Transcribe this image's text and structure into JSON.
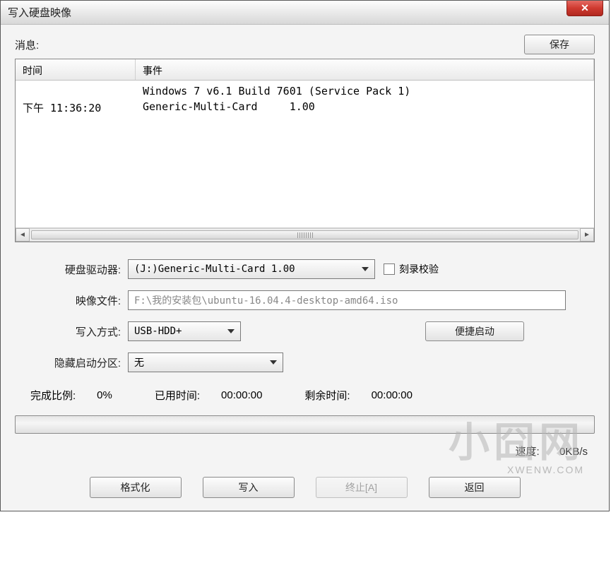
{
  "window": {
    "title": "写入硬盘映像"
  },
  "top": {
    "msg_label": "消息:",
    "save_btn": "保存"
  },
  "log": {
    "col_time": "时间",
    "col_event": "事件",
    "rows": [
      {
        "time": "",
        "event": "Windows 7 v6.1 Build 7601 (Service Pack 1)"
      },
      {
        "time": "下午 11:36:20",
        "event": "Generic-Multi-Card     1.00"
      }
    ]
  },
  "form": {
    "drive_label": "硬盘驱动器:",
    "drive_value": "(J:)Generic-Multi-Card     1.00",
    "verify_label": "刻录校验",
    "image_label": "映像文件:",
    "image_value": "F:\\我的安装包\\ubuntu-16.04.4-desktop-amd64.iso",
    "write_mode_label": "写入方式:",
    "write_mode_value": "USB-HDD+",
    "quick_boot_btn": "便捷启动",
    "hidden_label": "隐藏启动分区:",
    "hidden_value": "无"
  },
  "stats": {
    "done_label": "完成比例:",
    "done_value": "0%",
    "elapsed_label": "已用时间:",
    "elapsed_value": "00:00:00",
    "remain_label": "剩余时间:",
    "remain_value": "00:00:00",
    "speed_label": "速度:",
    "speed_value": "0KB/s"
  },
  "buttons": {
    "format": "格式化",
    "write": "写入",
    "abort": "终止[A]",
    "back": "返回"
  },
  "watermark": {
    "main": "小囧网",
    "sub": "XWENW.COM"
  }
}
